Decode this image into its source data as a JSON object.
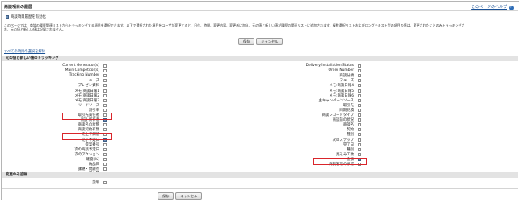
{
  "header": {
    "title": "商談項目の履歴",
    "help_label": "このページのヘルプ"
  },
  "enable_checkbox": {
    "label": "商談項目履歴を有効化",
    "checked": true
  },
  "description": [
    "このページでは、商談の履歴関連リストからトラッキングする項目を選択できます。以下で選択された項目をユーザが変更すると、日付、時間、変更内容、変更者に加え、元の値と新しい値が履歴の関連リストに追加されます。複数選択リストおよびロングテキスト型の項目の値は、変更されたことのみトラッキングさ",
    "れ、元の値と新しい値は記録されません。"
  ],
  "buttons": {
    "save": "保存",
    "cancel": "キャンセル"
  },
  "deselect_all_link": "すべての項目の選択を解除",
  "section_tracking": "元の値と新しい値のトラッキング",
  "section_changes": "変更のみ追跡",
  "left_fields": [
    {
      "label": "Current Generator(s)",
      "checked": false
    },
    {
      "label": "Main Competitor(s)",
      "checked": false
    },
    {
      "label": "Tracking Number",
      "checked": false
    },
    {
      "label": "ニーズ",
      "checked": false
    },
    {
      "label": "プレゼン資料",
      "checked": false
    },
    {
      "label": "メモ:商談日報1",
      "checked": false
    },
    {
      "label": "メモ:商談日報2",
      "checked": false
    },
    {
      "label": "メモ:商談日報3",
      "checked": false
    },
    {
      "label": "リードソース",
      "checked": false
    },
    {
      "label": "割引率",
      "checked": false
    },
    {
      "label": "取引先責任者",
      "checked": false
    },
    {
      "label": "商談 所有者",
      "checked": true
    },
    {
      "label": "商談名の状態",
      "checked": false
    },
    {
      "label": "商談契約有無",
      "checked": false
    },
    {
      "label": "売上予測値",
      "checked": false
    },
    {
      "label": "完了予定日",
      "checked": true
    },
    {
      "label": "提案番号",
      "checked": false
    },
    {
      "label": "次の商談予定日",
      "checked": false
    },
    {
      "label": "次のアクション",
      "checked": false
    },
    {
      "label": "確度(%)",
      "checked": false
    },
    {
      "label": "納品日",
      "checked": false
    },
    {
      "label": "課題・問題点",
      "checked": false
    },
    {
      "label": "非公開",
      "checked": false
    }
  ],
  "right_fields": [
    {
      "label": "Delivery/Installation Status",
      "checked": false
    },
    {
      "label": "Order Number",
      "checked": false
    },
    {
      "label": "商談分類",
      "checked": false
    },
    {
      "label": "フェーズ",
      "checked": false
    },
    {
      "label": "メモ:商談日報4",
      "checked": false
    },
    {
      "label": "メモ:商談日報5",
      "checked": false
    },
    {
      "label": "メモ:商談日報6",
      "checked": false
    },
    {
      "label": "主キャンペーンソース",
      "checked": false
    },
    {
      "label": "取引先",
      "checked": false
    },
    {
      "label": "同期見積",
      "checked": false
    },
    {
      "label": "商談レコードタイプ",
      "checked": false
    },
    {
      "label": "商談前の状況",
      "checked": false
    },
    {
      "label": "商談名",
      "checked": false
    },
    {
      "label": "契約",
      "checked": false
    },
    {
      "label": "種別",
      "checked": false
    },
    {
      "label": "次のステップ",
      "checked": false
    },
    {
      "label": "完了日",
      "checked": false
    },
    {
      "label": "種別",
      "checked": false
    },
    {
      "label": "見込み工数",
      "checked": false
    },
    {
      "label": "金額",
      "checked": true
    },
    {
      "label": "商談管理の承認",
      "checked": false
    }
  ],
  "changes_only_fields": [
    {
      "label": "説明",
      "checked": false
    }
  ]
}
